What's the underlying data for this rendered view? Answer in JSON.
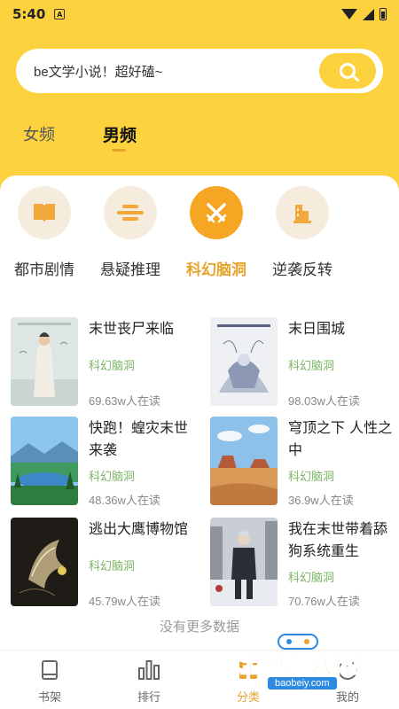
{
  "status": {
    "time": "5:40",
    "a_badge": "A"
  },
  "search": {
    "placeholder": "be文学小说！超好磕~"
  },
  "gender_tabs": [
    {
      "label": "女频",
      "active": false
    },
    {
      "label": "男频",
      "active": true
    }
  ],
  "categories": [
    {
      "label": "都市剧情",
      "icon": "book-icon",
      "active": false
    },
    {
      "label": "悬疑推理",
      "icon": "cloud-icon",
      "active": false
    },
    {
      "label": "科幻脑洞",
      "icon": "crossed-swords-icon",
      "active": true
    },
    {
      "label": "逆袭反转",
      "icon": "building-icon",
      "active": false
    }
  ],
  "books": [
    {
      "title": "末世丧尸来临",
      "tag": "科幻脑洞",
      "readers": "69.63w人在读"
    },
    {
      "title": "末日围城",
      "tag": "科幻脑洞",
      "readers": "98.03w人在读"
    },
    {
      "title": "快跑！蝗灾末世来袭",
      "tag": "科幻脑洞",
      "readers": "48.36w人在读"
    },
    {
      "title": "穹顶之下 人性之中",
      "tag": "科幻脑洞",
      "readers": "36.9w人在读"
    },
    {
      "title": "逃出大鹰博物馆",
      "tag": "科幻脑洞",
      "readers": "45.79w人在读"
    },
    {
      "title": "我在末世带着舔狗系统重生",
      "tag": "科幻脑洞",
      "readers": "70.76w人在读"
    }
  ],
  "no_more": "没有更多数据",
  "nav": [
    {
      "label": "书架",
      "icon": "bookshelf-icon"
    },
    {
      "label": "排行",
      "icon": "ranking-icon"
    },
    {
      "label": "分类",
      "icon": "category-icon",
      "active": true
    },
    {
      "label": "我的",
      "icon": "profile-icon"
    }
  ],
  "watermark": {
    "text": "宝贝游戏网",
    "url": "baobeiy.com"
  },
  "colors": {
    "primary": "#FCD23F",
    "accent": "#E8A42A",
    "tag": "#7BB664"
  }
}
